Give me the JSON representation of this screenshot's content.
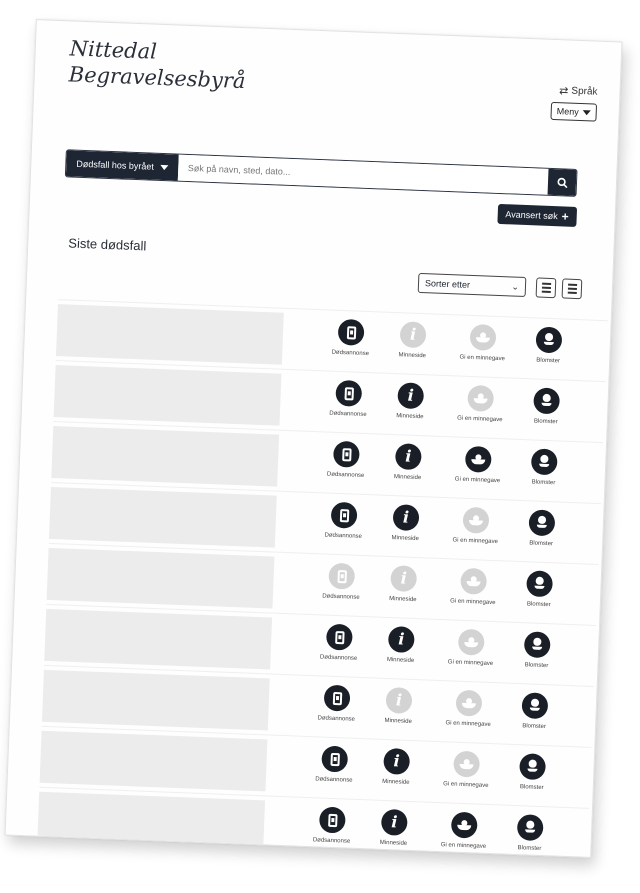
{
  "logo": {
    "line1": "Nittedal",
    "line2": "Begravelsesbyrå"
  },
  "header": {
    "language_label": "Språk",
    "menu_label": "Meny"
  },
  "search": {
    "type_label": "Dødsfall hos byrået",
    "placeholder": "Søk på navn, sted, dato...",
    "advanced_label": "Avansert søk"
  },
  "section": {
    "title": "Siste dødsfall"
  },
  "sort": {
    "label": "Sorter etter"
  },
  "action_labels": [
    "Dødsannonse",
    "Minneside",
    "Gi en minnegave",
    "Blomster"
  ],
  "rows": [
    {
      "actions": [
        true,
        false,
        false,
        true
      ]
    },
    {
      "actions": [
        true,
        true,
        false,
        true
      ]
    },
    {
      "actions": [
        true,
        true,
        true,
        true
      ]
    },
    {
      "actions": [
        true,
        true,
        false,
        true
      ]
    },
    {
      "actions": [
        false,
        false,
        false,
        true
      ]
    },
    {
      "actions": [
        true,
        true,
        false,
        true
      ]
    },
    {
      "actions": [
        true,
        false,
        false,
        true
      ]
    },
    {
      "actions": [
        true,
        true,
        false,
        true
      ]
    },
    {
      "actions": [
        true,
        true,
        true,
        true
      ]
    }
  ],
  "icons": [
    "phone-icon",
    "info-icon",
    "hands-icon",
    "flower-icon"
  ],
  "colors": {
    "primary": "#1e2634",
    "inactive": "#d3d3d3",
    "thumb": "#ececec"
  }
}
